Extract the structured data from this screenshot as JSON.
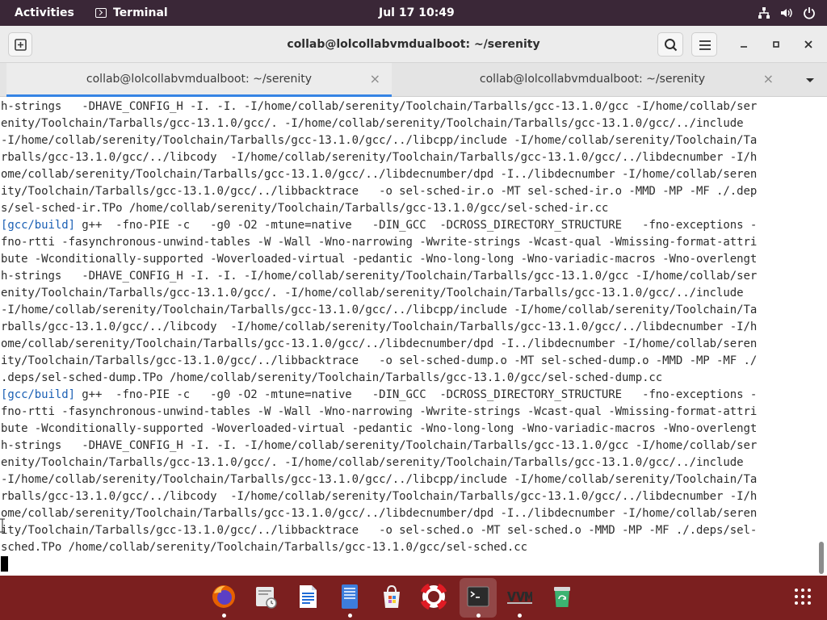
{
  "topbar": {
    "activities": "Activities",
    "app_name": "Terminal",
    "clock": "Jul 17  10:49",
    "system_icons": [
      "network-icon",
      "volume-icon",
      "power-icon"
    ]
  },
  "window": {
    "title": "collab@lolcollabvmdualboot: ~/serenity",
    "buttons": [
      "new-tab-icon",
      "search-icon",
      "menu-icon",
      "minimize-icon",
      "maximize-icon",
      "close-icon"
    ]
  },
  "tabs": [
    {
      "label": "collab@lolcollabvmdualboot: ~/serenity",
      "active": true
    },
    {
      "label": "collab@lolcollabvmdualboot: ~/serenity",
      "active": false
    }
  ],
  "terminal": {
    "lines": [
      "h-strings   -DHAVE_CONFIG_H -I. -I. -I/home/collab/serenity/Toolchain/Tarballs/gcc-13.1.0/gcc -I/home/collab/ser",
      "enity/Toolchain/Tarballs/gcc-13.1.0/gcc/. -I/home/collab/serenity/Toolchain/Tarballs/gcc-13.1.0/gcc/../include",
      "-I/home/collab/serenity/Toolchain/Tarballs/gcc-13.1.0/gcc/../libcpp/include -I/home/collab/serenity/Toolchain/Ta",
      "rballs/gcc-13.1.0/gcc/../libcody  -I/home/collab/serenity/Toolchain/Tarballs/gcc-13.1.0/gcc/../libdecnumber -I/h",
      "ome/collab/serenity/Toolchain/Tarballs/gcc-13.1.0/gcc/../libdecnumber/dpd -I../libdecnumber -I/home/collab/seren",
      "ity/Toolchain/Tarballs/gcc-13.1.0/gcc/../libbacktrace   -o sel-sched-ir.o -MT sel-sched-ir.o -MMD -MP -MF ./.dep",
      "s/sel-sched-ir.TPo /home/collab/serenity/Toolchain/Tarballs/gcc-13.1.0/gcc/sel-sched-ir.cc",
      "[gcc/build] g++  -fno-PIE -c   -g0 -O2 -mtune=native   -DIN_GCC  -DCROSS_DIRECTORY_STRUCTURE   -fno-exceptions -",
      "fno-rtti -fasynchronous-unwind-tables -W -Wall -Wno-narrowing -Wwrite-strings -Wcast-qual -Wmissing-format-attri",
      "bute -Wconditionally-supported -Woverloaded-virtual -pedantic -Wno-long-long -Wno-variadic-macros -Wno-overlengt",
      "h-strings   -DHAVE_CONFIG_H -I. -I. -I/home/collab/serenity/Toolchain/Tarballs/gcc-13.1.0/gcc -I/home/collab/ser",
      "enity/Toolchain/Tarballs/gcc-13.1.0/gcc/. -I/home/collab/serenity/Toolchain/Tarballs/gcc-13.1.0/gcc/../include",
      "-I/home/collab/serenity/Toolchain/Tarballs/gcc-13.1.0/gcc/../libcpp/include -I/home/collab/serenity/Toolchain/Ta",
      "rballs/gcc-13.1.0/gcc/../libcody  -I/home/collab/serenity/Toolchain/Tarballs/gcc-13.1.0/gcc/../libdecnumber -I/h",
      "ome/collab/serenity/Toolchain/Tarballs/gcc-13.1.0/gcc/../libdecnumber/dpd -I../libdecnumber -I/home/collab/seren",
      "ity/Toolchain/Tarballs/gcc-13.1.0/gcc/../libbacktrace   -o sel-sched-dump.o -MT sel-sched-dump.o -MMD -MP -MF ./",
      ".deps/sel-sched-dump.TPo /home/collab/serenity/Toolchain/Tarballs/gcc-13.1.0/gcc/sel-sched-dump.cc",
      "[gcc/build] g++  -fno-PIE -c   -g0 -O2 -mtune=native   -DIN_GCC  -DCROSS_DIRECTORY_STRUCTURE   -fno-exceptions -",
      "fno-rtti -fasynchronous-unwind-tables -W -Wall -Wno-narrowing -Wwrite-strings -Wcast-qual -Wmissing-format-attri",
      "bute -Wconditionally-supported -Woverloaded-virtual -pedantic -Wno-long-long -Wno-variadic-macros -Wno-overlengt",
      "h-strings   -DHAVE_CONFIG_H -I. -I. -I/home/collab/serenity/Toolchain/Tarballs/gcc-13.1.0/gcc -I/home/collab/ser",
      "enity/Toolchain/Tarballs/gcc-13.1.0/gcc/. -I/home/collab/serenity/Toolchain/Tarballs/gcc-13.1.0/gcc/../include",
      "-I/home/collab/serenity/Toolchain/Tarballs/gcc-13.1.0/gcc/../libcpp/include -I/home/collab/serenity/Toolchain/Ta",
      "rballs/gcc-13.1.0/gcc/../libcody  -I/home/collab/serenity/Toolchain/Tarballs/gcc-13.1.0/gcc/../libdecnumber -I/h",
      "ome/collab/serenity/Toolchain/Tarballs/gcc-13.1.0/gcc/../libdecnumber/dpd -I../libdecnumber -I/home/collab/seren",
      "ity/Toolchain/Tarballs/gcc-13.1.0/gcc/../libbacktrace   -o sel-sched.o -MT sel-sched.o -MMD -MP -MF ./.deps/sel-",
      "sched.TPo /home/collab/serenity/Toolchain/Tarballs/gcc-13.1.0/gcc/sel-sched.cc"
    ]
  },
  "dock": {
    "apps": [
      {
        "icon": "firefox-icon",
        "running": true
      },
      {
        "icon": "evolution-mail-icon",
        "running": false
      },
      {
        "icon": "libreoffice-writer-icon",
        "running": false
      },
      {
        "icon": "files-icon",
        "running": true
      },
      {
        "icon": "software-center-icon",
        "running": false
      },
      {
        "icon": "help-icon",
        "running": false
      },
      {
        "icon": "terminal-icon",
        "running": true,
        "active": true
      },
      {
        "icon": "virtual-machine-manager-icon",
        "running": true
      },
      {
        "icon": "trash-icon",
        "running": false
      }
    ],
    "show_apps_icon": "app-grid-icon"
  },
  "colors": {
    "topbar": "#3a2737",
    "dock": "#7b1f1f",
    "tab_accent": "#3584e4",
    "terminal_bg": "#ffffff",
    "terminal_fg": "#2c2c2c",
    "prefix_blue": "#1a5fb4"
  }
}
